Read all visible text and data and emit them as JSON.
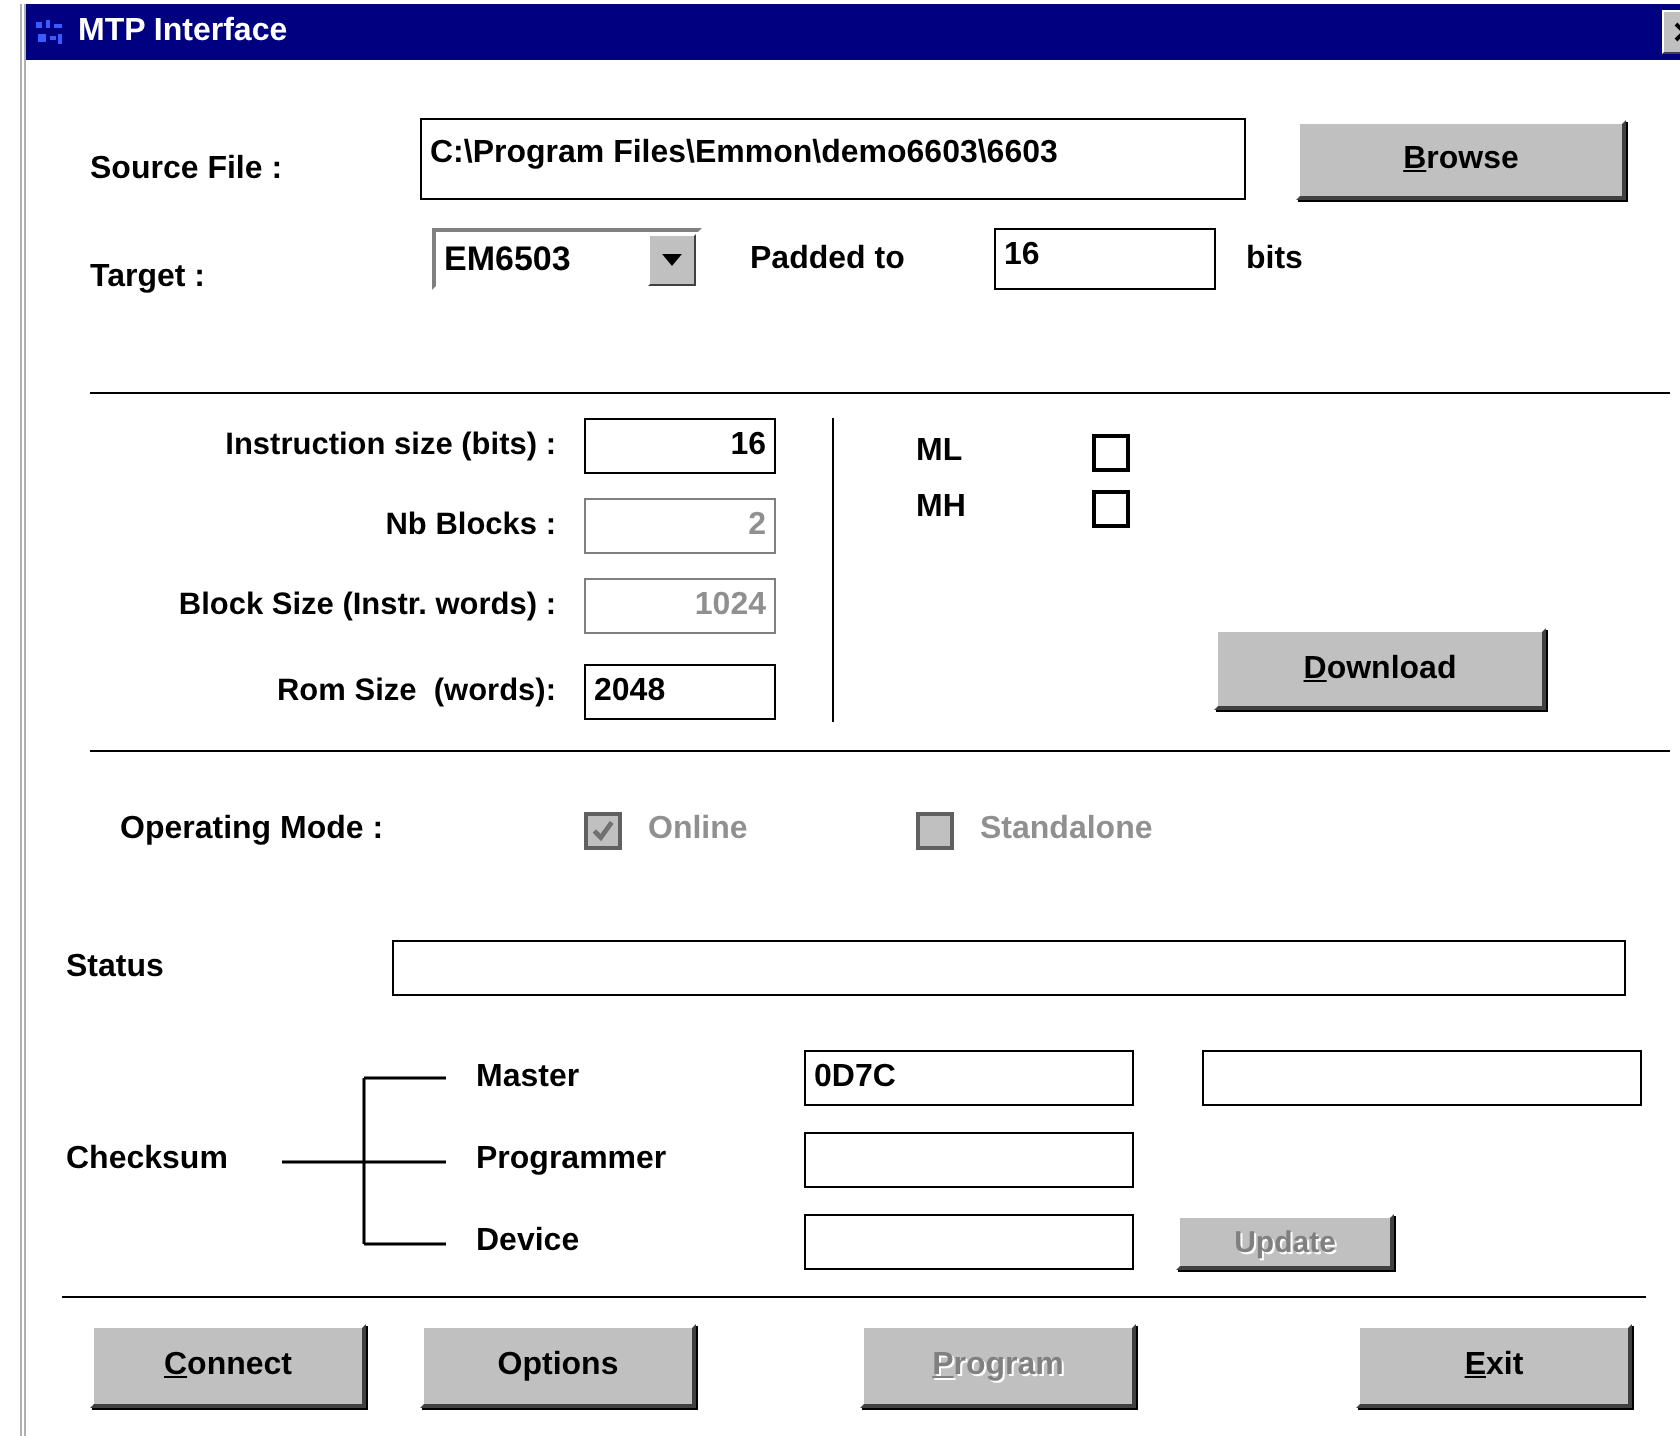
{
  "window": {
    "title": "MTP Interface"
  },
  "source_file": {
    "label": "Source File :",
    "value": "C:\\Program Files\\Emmon\\demo6603\\6603"
  },
  "browse_button": {
    "label": "Browse",
    "access_key": true
  },
  "target": {
    "label": "Target :",
    "value": "EM6503"
  },
  "padded": {
    "label": "Padded to",
    "value": "16",
    "unit": "bits"
  },
  "memory_fields": [
    {
      "label": "Instruction size (bits) :",
      "value": "16",
      "kind": "number",
      "disabled": false
    },
    {
      "label": "Nb Blocks :",
      "value": "2",
      "kind": "number",
      "disabled": true
    },
    {
      "label": "Block Size (Instr. words) :",
      "value": "1024",
      "kind": "number",
      "disabled": true
    },
    {
      "label": "Rom Size  (words):",
      "value": "2048",
      "kind": "text",
      "disabled": false
    }
  ],
  "flags": [
    {
      "label": "ML",
      "checked": false
    },
    {
      "label": "MH",
      "checked": false
    }
  ],
  "download_button": {
    "label": "Download",
    "access_key": true
  },
  "operating_mode": {
    "label": "Operating Mode :",
    "options": [
      {
        "label": "Online",
        "checked": true,
        "disabled": true
      },
      {
        "label": "Standalone",
        "checked": false,
        "disabled": true
      }
    ]
  },
  "status": {
    "label": "Status"
  },
  "checksum": {
    "label": "Checksum",
    "rows": [
      {
        "kind": "pair",
        "label": "Master",
        "value": "0D7C"
      },
      {
        "kind": "single",
        "label": "Programmer"
      },
      {
        "kind": "update",
        "label": "Device",
        "button": {
          "label": "Update",
          "disabled": true
        }
      }
    ]
  },
  "buttons": [
    {
      "label": "Connect",
      "access_key": true,
      "disabled": false
    },
    {
      "label": "Options",
      "access_key": false,
      "disabled": false
    },
    {
      "label": "Program",
      "access_key": true,
      "disabled": true
    },
    {
      "label": "Exit",
      "access_key": true,
      "disabled": false
    }
  ]
}
